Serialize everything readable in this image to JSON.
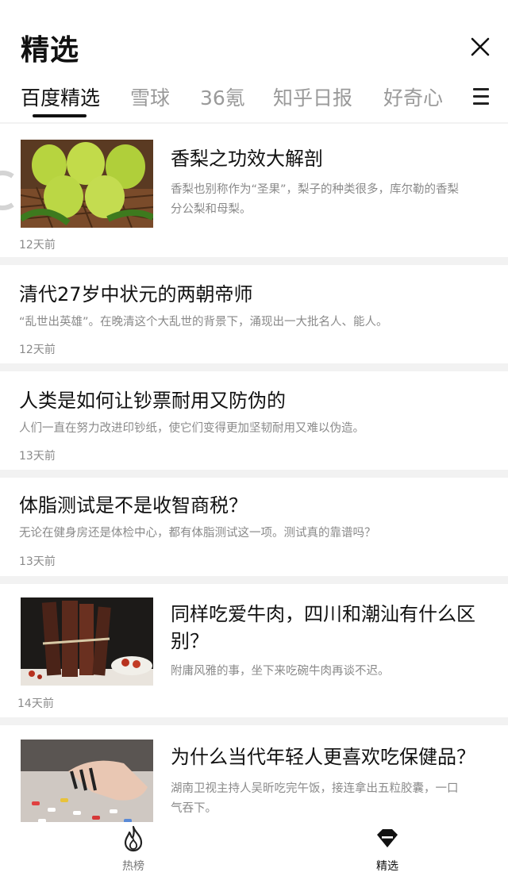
{
  "header": {
    "title": "精选"
  },
  "tabs": [
    {
      "label": "百度精选"
    },
    {
      "label": "雪球"
    },
    {
      "label": "36氪"
    },
    {
      "label": "知乎日报"
    },
    {
      "label": "好奇心"
    }
  ],
  "articles": [
    {
      "title": "香梨之功效大解剖",
      "summary_lines": [
        "香梨也别称作为“圣果”，梨子的种类很多，库尔勒的香梨",
        "分公梨和母梨。"
      ],
      "time": "12天前",
      "image": "green-pears"
    },
    {
      "title": "清代27岁中状元的两朝帝师",
      "summary": "“乱世出英雄”。在晚清这个大乱世的背景下，涌现出一大批名人、能人。",
      "time": "12天前"
    },
    {
      "title": "人类是如何让钞票耐用又防伪的",
      "summary": "人们一直在努力改进印钞纸，使它们变得更加坚韧耐用又难以伪造。",
      "time": "13天前"
    },
    {
      "title": "体脂测试是不是收智商税？",
      "summary": "无论在健身房还是体检中心，都有体脂测试这一项。测试真的靠谱吗？",
      "time": "13天前"
    },
    {
      "title_lines": [
        "同样吃爱牛肉，四川和潮汕有什么区",
        "别？"
      ],
      "summary": "附庸风雅的事，坐下来吃碗牛肉再谈不迟。",
      "time": "14天前",
      "image": "dried-beef"
    },
    {
      "title": "为什么当代年轻人更喜欢吃保健品？",
      "summary_lines": [
        "湖南卫视主持人吴昕吃完午饭，接连拿出五粒胶囊，一口",
        "气吞下。"
      ],
      "image": "pills-hand"
    }
  ],
  "bottom_nav": [
    {
      "label": "热榜",
      "icon": "flame-icon"
    },
    {
      "label": "精选",
      "icon": "diamond-icon",
      "active": true
    }
  ]
}
